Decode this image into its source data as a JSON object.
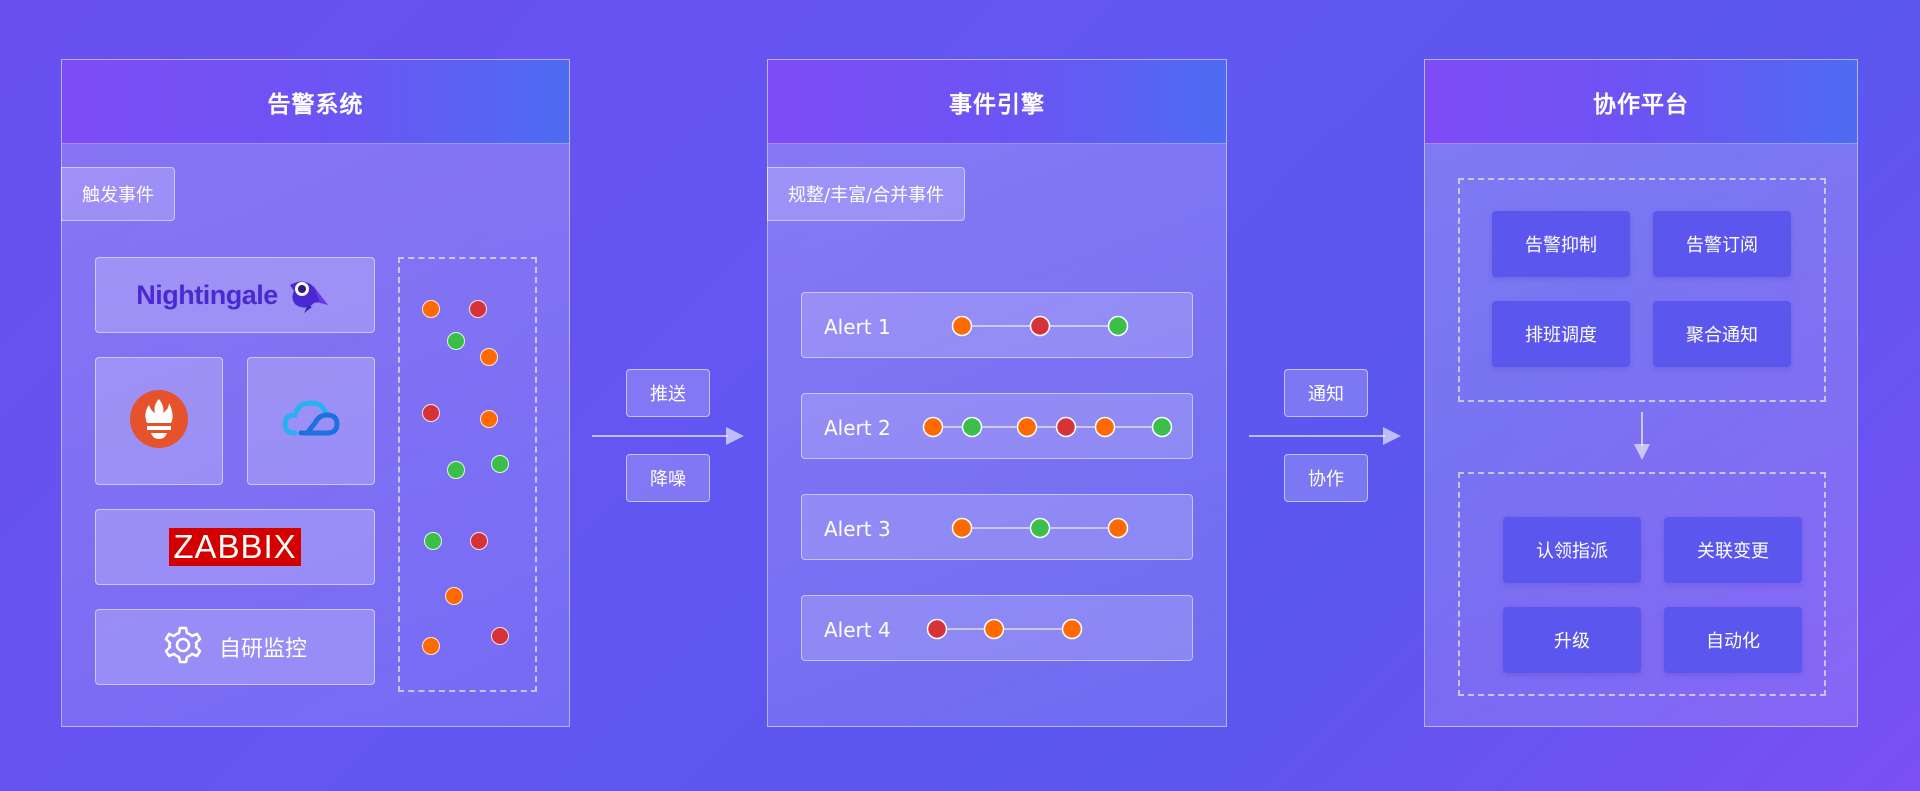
{
  "panels": {
    "alert_system": {
      "title": "告警系统",
      "tag": "触发事件"
    },
    "event_engine": {
      "title": "事件引擎",
      "tag": "规整/丰富/合并事件"
    },
    "collab_platform": {
      "title": "协作平台"
    }
  },
  "sources": {
    "nightingale": "Nightingale",
    "zabbix": "ZABBIX",
    "self_monitor": "自研监控"
  },
  "flow_left": {
    "push": "推送",
    "denoise": "降噪"
  },
  "flow_right": {
    "notify": "通知",
    "collab": "协作"
  },
  "alerts": [
    {
      "label": "Alert 1",
      "events": [
        "orange",
        "red",
        "green"
      ]
    },
    {
      "label": "Alert 2",
      "events": [
        "orange",
        "green",
        "orange",
        "red",
        "orange",
        "green"
      ]
    },
    {
      "label": "Alert 3",
      "events": [
        "orange",
        "green",
        "orange"
      ]
    },
    {
      "label": "Alert 4",
      "events": [
        "red",
        "orange",
        "orange"
      ]
    }
  ],
  "top_actions": [
    "告警抑制",
    "告警订阅",
    "排班调度",
    "聚合通知"
  ],
  "bottom_actions": [
    "认领指派",
    "关联变更",
    "升级",
    "自动化"
  ],
  "colors": {
    "orange": "#ff6a00",
    "red": "#d63339",
    "green": "#3cbf4a"
  },
  "icons": {
    "nightingale_bird": "bird-icon",
    "prometheus": "prometheus-icon",
    "cloud": "cloud-icon",
    "gear": "gear-icon"
  }
}
